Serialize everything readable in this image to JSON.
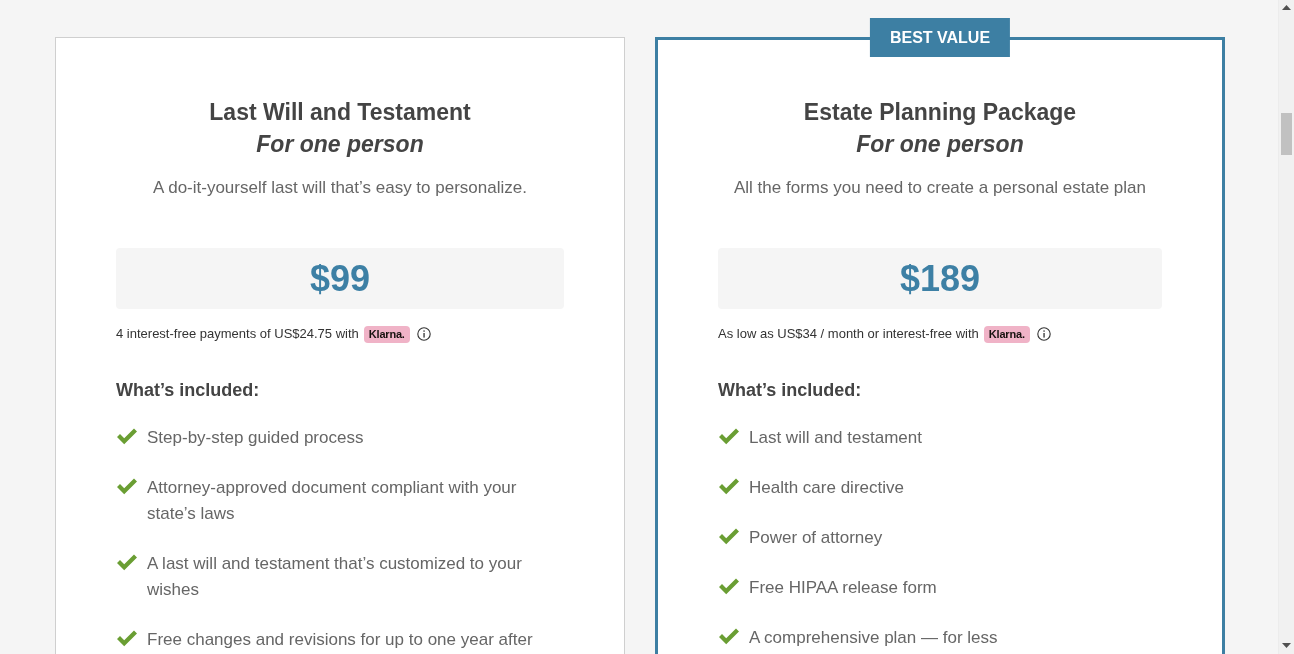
{
  "plans": [
    {
      "featured": false,
      "title": "Last Will and Testament",
      "subtitle": "For one person",
      "description": "A do-it-yourself last will that’s easy to personalize.",
      "price": "$99",
      "financing": {
        "text": "4 interest-free payments of US$24.75 with",
        "provider": "Klarna."
      },
      "included_heading": "What’s included:",
      "features": [
        "Step-by-step guided process",
        "Attorney-approved document compliant with your state’s laws",
        "A last will and testament that’s customized to your wishes",
        "Free changes and revisions for up to one year after"
      ]
    },
    {
      "featured": true,
      "badge": "BEST VALUE",
      "title": "Estate Planning Package",
      "subtitle": "For one person",
      "description": "All the forms you need to create a personal estate plan",
      "price": "$189",
      "financing": {
        "text": "As low as US$34 / month or interest-free with",
        "provider": "Klarna."
      },
      "included_heading": "What’s included:",
      "features": [
        "Last will and testament",
        "Health care directive",
        "Power of attorney",
        "Free HIPAA release form",
        "A comprehensive plan — for less"
      ]
    }
  ]
}
